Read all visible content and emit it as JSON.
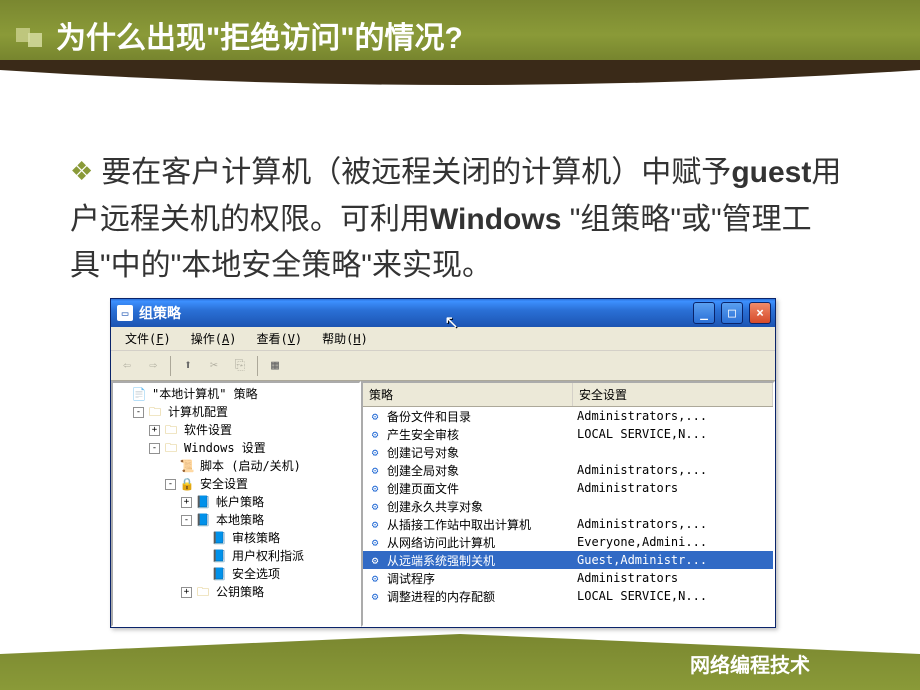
{
  "slide": {
    "title": "为什么出现\"拒绝访问\"的情况",
    "title_suffix": "?",
    "body_line1_prefix": "要在客户计算机（被远程关闭的计算机）中赋予",
    "body_bold1": "guest",
    "body_line1_mid": "用户远程关机的权限。可利用",
    "body_bold2": "Windows",
    "body_line2": "\"组策略\"或\"管理工具\"中的\"本地安全策略\"来实现。",
    "footer": "网络编程技术"
  },
  "window": {
    "title": "组策略",
    "menu": {
      "file": "文件",
      "file_hk": "F",
      "action": "操作",
      "action_hk": "A",
      "view": "查看",
      "view_hk": "V",
      "help": "帮助",
      "help_hk": "H"
    },
    "tree": {
      "root": "\"本地计算机\" 策略",
      "computer_config": "计算机配置",
      "software_settings": "软件设置",
      "windows_settings": "Windows 设置",
      "scripts": "脚本 (启动/关机)",
      "security_settings": "安全设置",
      "account_policies": "帐户策略",
      "local_policies": "本地策略",
      "audit_policy": "审核策略",
      "user_rights": "用户权利指派",
      "security_options": "安全选项",
      "public_key": "公钥策略"
    },
    "columns": {
      "policy": "策略",
      "security": "安全设置"
    },
    "rows": [
      {
        "policy": "备份文件和目录",
        "security": "Administrators,..."
      },
      {
        "policy": "产生安全审核",
        "security": "LOCAL SERVICE,N..."
      },
      {
        "policy": "创建记号对象",
        "security": ""
      },
      {
        "policy": "创建全局对象",
        "security": "Administrators,..."
      },
      {
        "policy": "创建页面文件",
        "security": "Administrators"
      },
      {
        "policy": "创建永久共享对象",
        "security": ""
      },
      {
        "policy": "从插接工作站中取出计算机",
        "security": "Administrators,..."
      },
      {
        "policy": "从网络访问此计算机",
        "security": "Everyone,Admini..."
      },
      {
        "policy": "从远端系统强制关机",
        "security": "Guest,Administr...",
        "selected": true
      },
      {
        "policy": "调试程序",
        "security": "Administrators"
      },
      {
        "policy": "调整进程的内存配额",
        "security": "LOCAL SERVICE,N..."
      }
    ]
  }
}
